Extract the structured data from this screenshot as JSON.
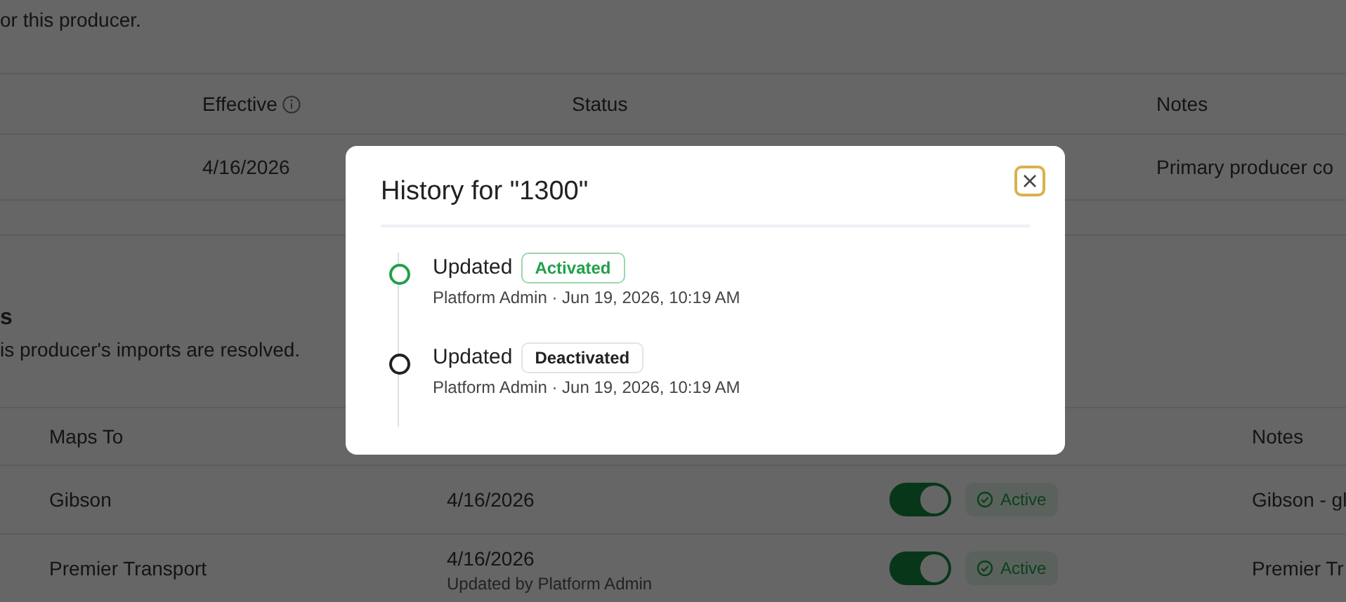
{
  "page": {
    "intro_text": "or this producer.",
    "codes_table": {
      "columns": [
        "Effective",
        "Status",
        "Notes"
      ],
      "rows": [
        {
          "effective": "4/16/2026",
          "notes": "Primary producer co"
        }
      ]
    },
    "section": {
      "title": "s",
      "subtitle": "is producer's imports are resolved."
    },
    "mappings_table": {
      "columns": [
        "Maps To",
        "Notes"
      ],
      "rows": [
        {
          "maps_to": "Gibson",
          "effective": "4/16/2026",
          "active": true,
          "status": "Active",
          "notes": "Gibson - gl"
        },
        {
          "maps_to": "Premier Transport",
          "effective": "4/16/2026",
          "updated_by": "Updated by Platform Admin",
          "active": true,
          "status": "Active",
          "notes": "Premier Tr"
        }
      ]
    }
  },
  "modal": {
    "title": "History for \"1300\"",
    "close_focused": true,
    "entries": [
      {
        "action": "Updated",
        "badge": "Activated",
        "kind": "activated",
        "meta": "Platform Admin · Jun 19, 2026, 10:19 AM"
      },
      {
        "action": "Updated",
        "badge": "Deactivated",
        "kind": "deactivated",
        "meta": "Platform Admin · Jun 19, 2026, 10:19 AM"
      }
    ]
  }
}
